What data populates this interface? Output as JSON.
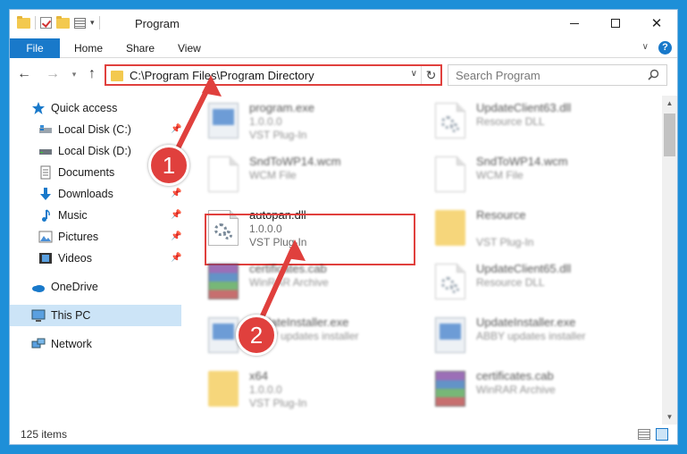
{
  "window": {
    "title": "Program"
  },
  "ribbon": {
    "tabs": [
      {
        "label": "File"
      },
      {
        "label": "Home"
      },
      {
        "label": "Share"
      },
      {
        "label": "View"
      }
    ],
    "help": "?"
  },
  "nav": {
    "address": "C:\\Program Files\\Program Directory",
    "search_placeholder": "Search Program"
  },
  "sidebar": {
    "items": [
      {
        "label": "Quick access",
        "icon": "star-icon"
      },
      {
        "label": "Local Disk (C:)",
        "icon": "drive-icon",
        "pinned": true
      },
      {
        "label": "Local Disk (D:)",
        "icon": "drive-icon"
      },
      {
        "label": "Documents",
        "icon": "documents-icon",
        "pinned": true
      },
      {
        "label": "Downloads",
        "icon": "download-icon",
        "pinned": true
      },
      {
        "label": "Music",
        "icon": "music-icon",
        "pinned": true
      },
      {
        "label": "Pictures",
        "icon": "pictures-icon",
        "pinned": true
      },
      {
        "label": "Videos",
        "icon": "videos-icon",
        "pinned": true
      },
      {
        "label": "OneDrive",
        "icon": "cloud-icon"
      },
      {
        "label": "This PC",
        "icon": "computer-icon",
        "selected": true
      },
      {
        "label": "Network",
        "icon": "network-icon"
      }
    ]
  },
  "files": [
    {
      "name": "program.exe",
      "meta1": "1.0.0.0",
      "meta2": "VST Plug-In",
      "icon": "exe-icon"
    },
    {
      "name": "UpdateClient63.dll",
      "meta1": "Resource DLL",
      "meta2": "",
      "icon": "dll-icon"
    },
    {
      "name": "SndToWP14.wcm",
      "meta1": "WCM File",
      "meta2": "",
      "icon": "document-icon"
    },
    {
      "name": "SndToWP14.wcm",
      "meta1": "WCM File",
      "meta2": "",
      "icon": "document-icon"
    },
    {
      "name": "autopan.dll",
      "meta1": "1.0.0.0",
      "meta2": "VST Plug-In",
      "icon": "dll-icon"
    },
    {
      "name": "Resource",
      "meta1": "VST Plug-In",
      "meta2": "",
      "icon": "folder-icon"
    },
    {
      "name": "certificates.cab",
      "meta1": "WinRAR Archive",
      "meta2": "",
      "icon": "winrar-icon"
    },
    {
      "name": "UpdateClient65.dll",
      "meta1": "Resource DLL",
      "meta2": "",
      "icon": "dll-icon"
    },
    {
      "name": "UpdateInstaller.exe",
      "meta1": "ABBY updates installer",
      "meta2": "",
      "icon": "exe-icon"
    },
    {
      "name": "UpdateInstaller.exe",
      "meta1": "ABBY updates installer",
      "meta2": "",
      "icon": "exe-icon"
    },
    {
      "name": "x64",
      "meta1": "1.0.0.0",
      "meta2": "VST Plug-In",
      "icon": "folder-icon"
    },
    {
      "name": "certificates.cab",
      "meta1": "WinRAR Archive",
      "meta2": "",
      "icon": "winrar-icon"
    }
  ],
  "status": {
    "item_count": "125 items"
  },
  "callouts": {
    "one": "1",
    "two": "2"
  },
  "colors": {
    "accent": "#1979ca",
    "highlight": "#e0403d",
    "desktop": "#1e8fd8",
    "selected": "#cce4f7"
  }
}
